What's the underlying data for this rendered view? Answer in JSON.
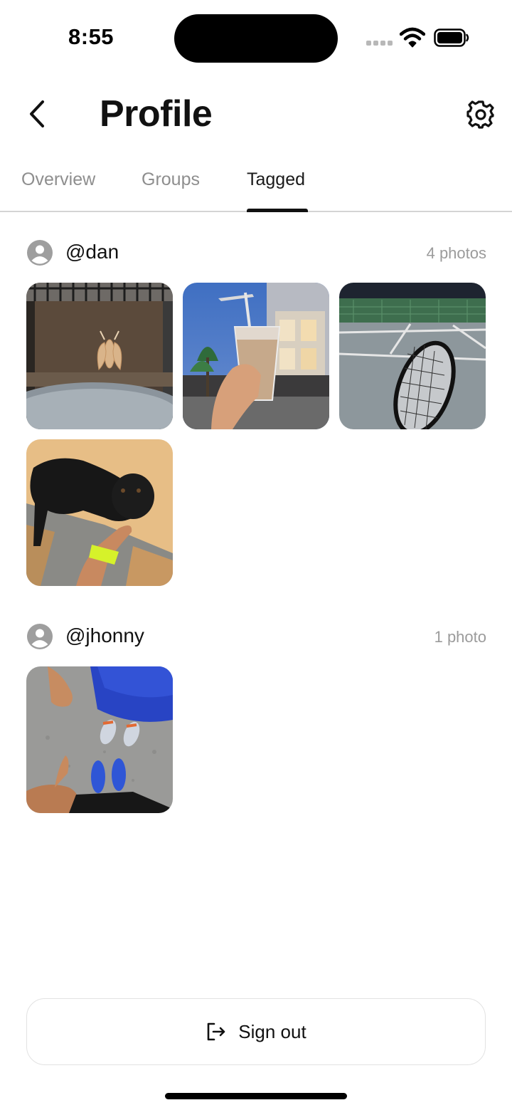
{
  "status_bar": {
    "time": "8:55",
    "icons": [
      "cellular-signal-icon",
      "wifi-icon",
      "battery-icon"
    ]
  },
  "header": {
    "title": "Profile",
    "back_icon": "chevron-left-icon",
    "settings_icon": "gear-icon"
  },
  "tabs": [
    {
      "label": "Overview",
      "active": false
    },
    {
      "label": "Groups",
      "active": false
    },
    {
      "label": "Tagged",
      "active": true
    }
  ],
  "tagged_groups": [
    {
      "username": "@dan",
      "count_label": "4 photos",
      "photos": [
        {
          "subject": "moth on glass door"
        },
        {
          "subject": "iced coffee held in hand"
        },
        {
          "subject": "tennis racket on court"
        },
        {
          "subject": "black dog with hand"
        }
      ]
    },
    {
      "username": "@jhonny",
      "count_label": "1 photo",
      "photos": [
        {
          "subject": "sneakers and thumbs up"
        }
      ]
    }
  ],
  "footer": {
    "signout_label": "Sign out",
    "signout_icon": "sign-out-icon"
  },
  "colors": {
    "text_primary": "#111111",
    "text_muted": "#8e8e8e",
    "divider": "#d4d4d4",
    "avatar_gray": "#9e9e9e"
  }
}
